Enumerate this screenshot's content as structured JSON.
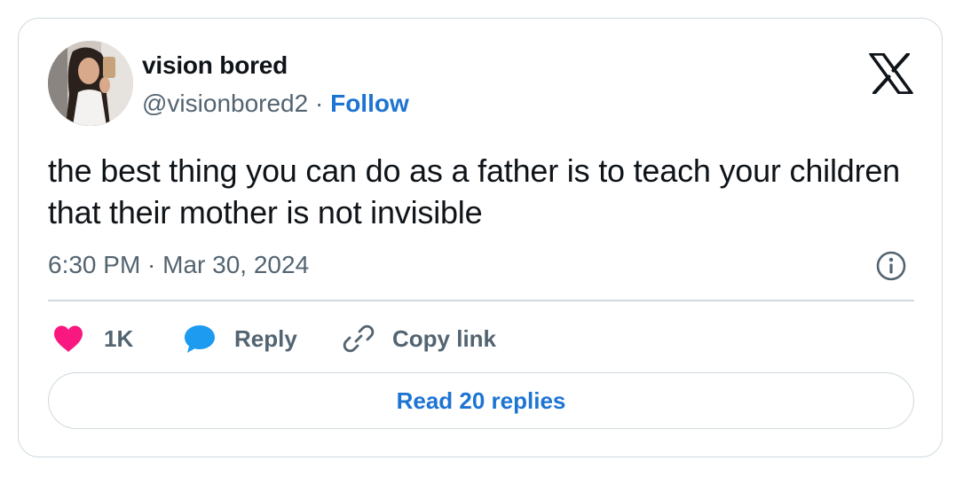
{
  "author": {
    "name": "vision bored",
    "handle": "@visionbored2",
    "separator": " · ",
    "follow_label": "Follow"
  },
  "tweet": {
    "text": "the best thing you can do as a father is to teach your children that their mother is not invisible",
    "timestamp": "6:30 PM · Mar 30, 2024"
  },
  "actions": {
    "like_count": "1K",
    "reply_label": "Reply",
    "copy_link_label": "Copy link"
  },
  "read_replies_label": "Read 20 replies",
  "icons": {
    "brand": "x-logo",
    "like": "heart-icon",
    "reply": "speech-bubble-icon",
    "copy": "link-icon",
    "info": "info-icon"
  },
  "colors": {
    "text_primary": "#0f1419",
    "text_secondary": "#536471",
    "link_blue": "#1d74d2",
    "like_pink": "#f91880",
    "reply_blue": "#1d9bf0",
    "border": "#cfd9de"
  }
}
